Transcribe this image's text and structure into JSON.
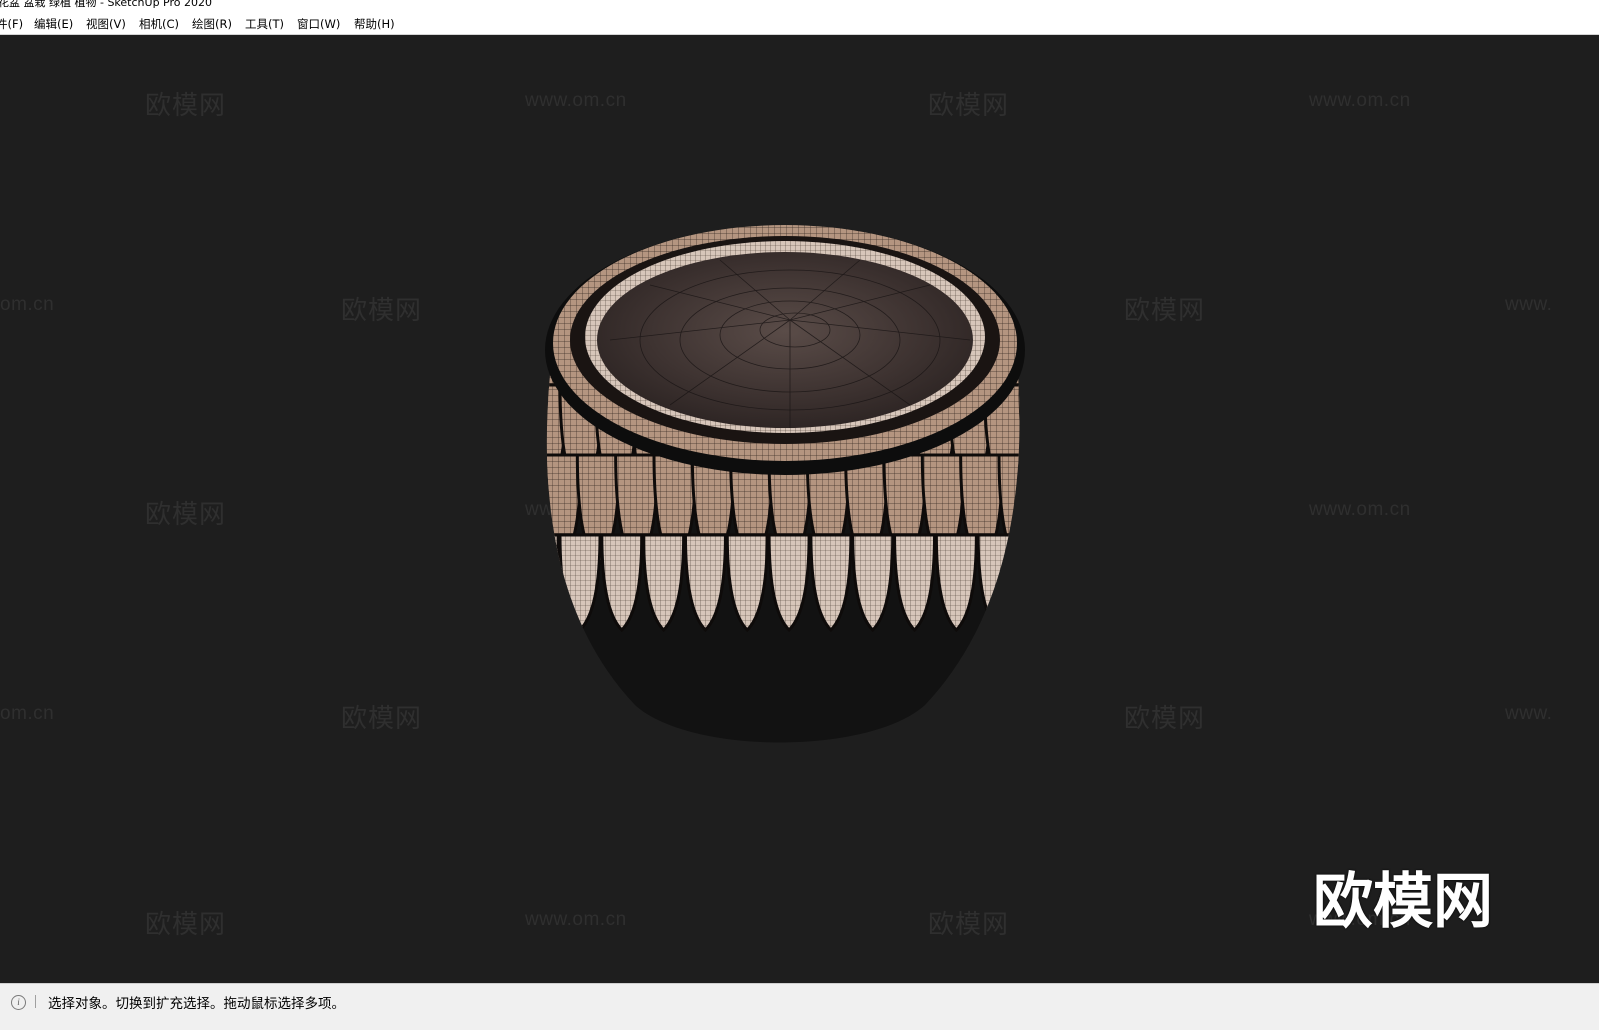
{
  "window": {
    "title": "花盆 盆栽 绿植 植物 - SketchUp Pro 2020"
  },
  "menu": [
    {
      "id": "file",
      "label": "件(F)"
    },
    {
      "id": "edit",
      "label": "编辑(E)"
    },
    {
      "id": "view",
      "label": "视图(V)"
    },
    {
      "id": "camera",
      "label": "相机(C)"
    },
    {
      "id": "draw",
      "label": "绘图(R)"
    },
    {
      "id": "tools",
      "label": "工具(T)"
    },
    {
      "id": "window",
      "label": "窗口(W)"
    },
    {
      "id": "help",
      "label": "帮助(H)"
    }
  ],
  "watermark": {
    "brand": "欧模网",
    "url": "www.om.cn",
    "url_partial_left": "om.cn",
    "url_partial_right": "www."
  },
  "status": {
    "icon": "info-icon",
    "text": "选择对象。切换到扩充选择。拖动鼠标选择多项。"
  }
}
